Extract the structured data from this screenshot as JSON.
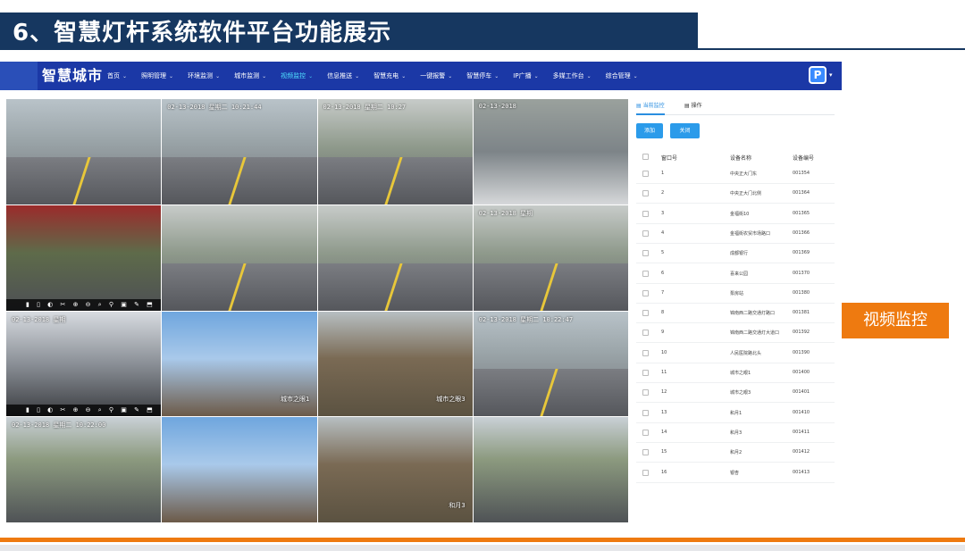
{
  "slide": {
    "title": "6、智慧灯杆系统软件平台功能展示",
    "callout": "视频监控"
  },
  "app": {
    "brand": "智慧城市",
    "nav": [
      {
        "label": "首页"
      },
      {
        "label": "照明管理"
      },
      {
        "label": "环境监测"
      },
      {
        "label": "城市监测"
      },
      {
        "label": "视频监控",
        "active": true
      },
      {
        "label": "信息推送"
      },
      {
        "label": "智慧充电"
      },
      {
        "label": "一键报警"
      },
      {
        "label": "智慧停车"
      },
      {
        "label": "IP广播"
      },
      {
        "label": "多媒工作台"
      },
      {
        "label": "综合管理"
      }
    ],
    "user_icon_letter": "P"
  },
  "cameras": [
    {
      "ts": "",
      "scene": "road"
    },
    {
      "ts": "02-13-2018 星期二 10:21:44",
      "scene": "road"
    },
    {
      "ts": "02-13-2018 星期二 10:27",
      "scene": "street"
    },
    {
      "ts": "02-13-2018",
      "scene": "crosswalk"
    },
    {
      "ts": "",
      "scene": "market",
      "ctrl": true
    },
    {
      "ts": "",
      "scene": "street"
    },
    {
      "ts": "",
      "scene": "street"
    },
    {
      "ts": "02-13-2018 星期",
      "scene": "street"
    },
    {
      "ts": "02-13-2018 星期",
      "scene": "shop",
      "ctrl": true
    },
    {
      "ts": "",
      "scene": "sky",
      "tag": "城市之眼1"
    },
    {
      "ts": "",
      "scene": "park",
      "tag": "城市之眼3"
    },
    {
      "ts": "02-13-2018 星期二 10:22:47",
      "scene": "road"
    },
    {
      "ts": "02-13-2018 星期二 10:22:00",
      "scene": "parking"
    },
    {
      "ts": "",
      "scene": "sky"
    },
    {
      "ts": "",
      "scene": "park",
      "tag": "和月3"
    },
    {
      "ts": "",
      "scene": "parking"
    }
  ],
  "panel": {
    "tabs": [
      "当前监控",
      "操作"
    ],
    "buttons": {
      "add": "添加",
      "close": "关闭"
    },
    "columns": {
      "no": "窗口号",
      "name": "设备名称",
      "code": "设备编号"
    },
    "rows": [
      {
        "no": "1",
        "name": "中央正大门东",
        "code": "001354"
      },
      {
        "no": "2",
        "name": "中央正大门北侧",
        "code": "001364"
      },
      {
        "no": "3",
        "name": "金福街10",
        "code": "001365"
      },
      {
        "no": "4",
        "name": "金福街农贸市场路口",
        "code": "001366"
      },
      {
        "no": "5",
        "name": "成都银行",
        "code": "001369"
      },
      {
        "no": "6",
        "name": "喜来公园",
        "code": "001370"
      },
      {
        "no": "7",
        "name": "泵房站",
        "code": "001380"
      },
      {
        "no": "8",
        "name": "锦南西二路交通灯路口",
        "code": "001381"
      },
      {
        "no": "9",
        "name": "锦南西二路交通灯大道口",
        "code": "001392"
      },
      {
        "no": "10",
        "name": "人民医院路北头",
        "code": "001390"
      },
      {
        "no": "11",
        "name": "城市之眼1",
        "code": "001400"
      },
      {
        "no": "12",
        "name": "城市之眼3",
        "code": "001401"
      },
      {
        "no": "13",
        "name": "和月1",
        "code": "001410"
      },
      {
        "no": "14",
        "name": "和月3",
        "code": "001411"
      },
      {
        "no": "15",
        "name": "和月2",
        "code": "001412"
      },
      {
        "no": "16",
        "name": "银杏",
        "code": "001413"
      }
    ]
  },
  "colors": {
    "title_bg": "#163760",
    "nav_bg": "#1b38a6",
    "accent_orange": "#ee7a10",
    "button_blue": "#2b9bea"
  }
}
